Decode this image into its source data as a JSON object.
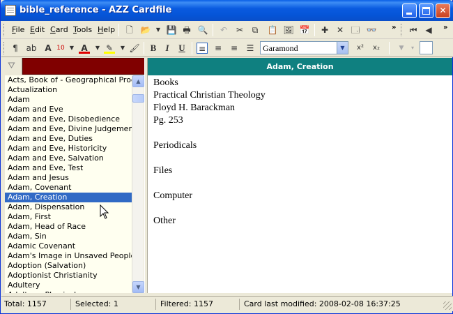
{
  "window": {
    "title": "bible_reference - AZZ Cardfile"
  },
  "menu": [
    {
      "label": "File",
      "key": "F"
    },
    {
      "label": "Edit",
      "key": "E"
    },
    {
      "label": "Card",
      "key": "C"
    },
    {
      "label": "Tools",
      "key": "T"
    },
    {
      "label": "Help",
      "key": "H"
    }
  ],
  "format_toolbar": {
    "font_size": "10",
    "font_name": "Garamond",
    "bold": "B",
    "italic": "I",
    "underline": "U"
  },
  "card_list": {
    "items": [
      "Acts, Book of - Geographical Progr...",
      "Actualization",
      "Adam",
      "Adam and Eve",
      "Adam and Eve, Disobedience",
      "Adam and Eve, Divine Judgement",
      "Adam and Eve, Duties",
      "Adam and Eve, Historicity",
      "Adam and Eve, Salvation",
      "Adam and Eve, Test",
      "Adam and Jesus",
      "Adam, Covenant",
      "Adam, Creation",
      "Adam, Dispensation",
      "Adam, First",
      "Adam, Head of Race",
      "Adam, Sin",
      "Adamic Covenant",
      "Adam's Image in Unsaved People",
      "Adoption (Salvation)",
      "Adoptionist Christianity",
      "Adultery",
      "Adultery, Physical"
    ],
    "selected_index": 12
  },
  "card": {
    "title": "Adam, Creation",
    "lines": [
      "Books",
      "Practical Christian Theology",
      "Floyd H. Barackman",
      "Pg. 253",
      "",
      "Periodicals",
      "",
      "Files",
      "",
      "Computer",
      "",
      "Other"
    ]
  },
  "status": {
    "total": "Total: 1157",
    "selected": "Selected: 1",
    "filtered": "Filtered: 1157",
    "modified": "Card last modified: 2008-02-08  16:37:25"
  },
  "colors": {
    "title_bar": "#0a5be0",
    "card_header": "#0f8080",
    "filter_box": "#800000",
    "list_background": "#fffff0",
    "selection": "#316ac5"
  }
}
